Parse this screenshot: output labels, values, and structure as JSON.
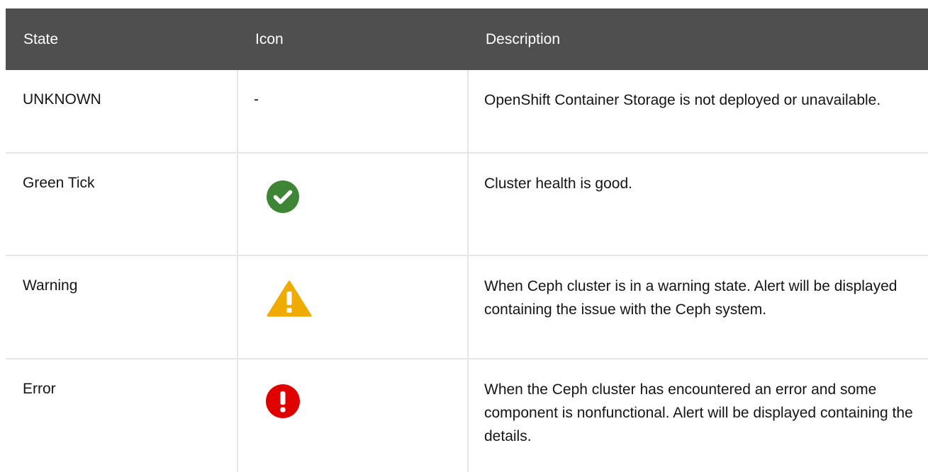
{
  "table": {
    "headers": [
      "State",
      "Icon",
      "Description"
    ],
    "rows": [
      {
        "state": "UNKNOWN",
        "icon_text": "-",
        "icon": "none",
        "description": "OpenShift Container Storage is not deployed or unavailable."
      },
      {
        "state": "Green Tick",
        "icon": "green-check-circle-icon",
        "icon_color": "#3e8635",
        "description": "Cluster health is good."
      },
      {
        "state": "Warning",
        "icon": "warning-triangle-icon",
        "icon_color": "#f0ab00",
        "description": "When Ceph cluster is in a warning state. Alert will be displayed containing the issue with the Ceph system."
      },
      {
        "state": "Error",
        "icon": "error-exclamation-circle-icon",
        "icon_color": "#e00000",
        "description": "When the Ceph cluster has encountered an error and some component is nonfunctional. Alert will be displayed containing the details."
      }
    ]
  },
  "colors": {
    "header_bg": "#4f4f4f",
    "header_text": "#ffffff",
    "border": "#e6e6e6"
  }
}
